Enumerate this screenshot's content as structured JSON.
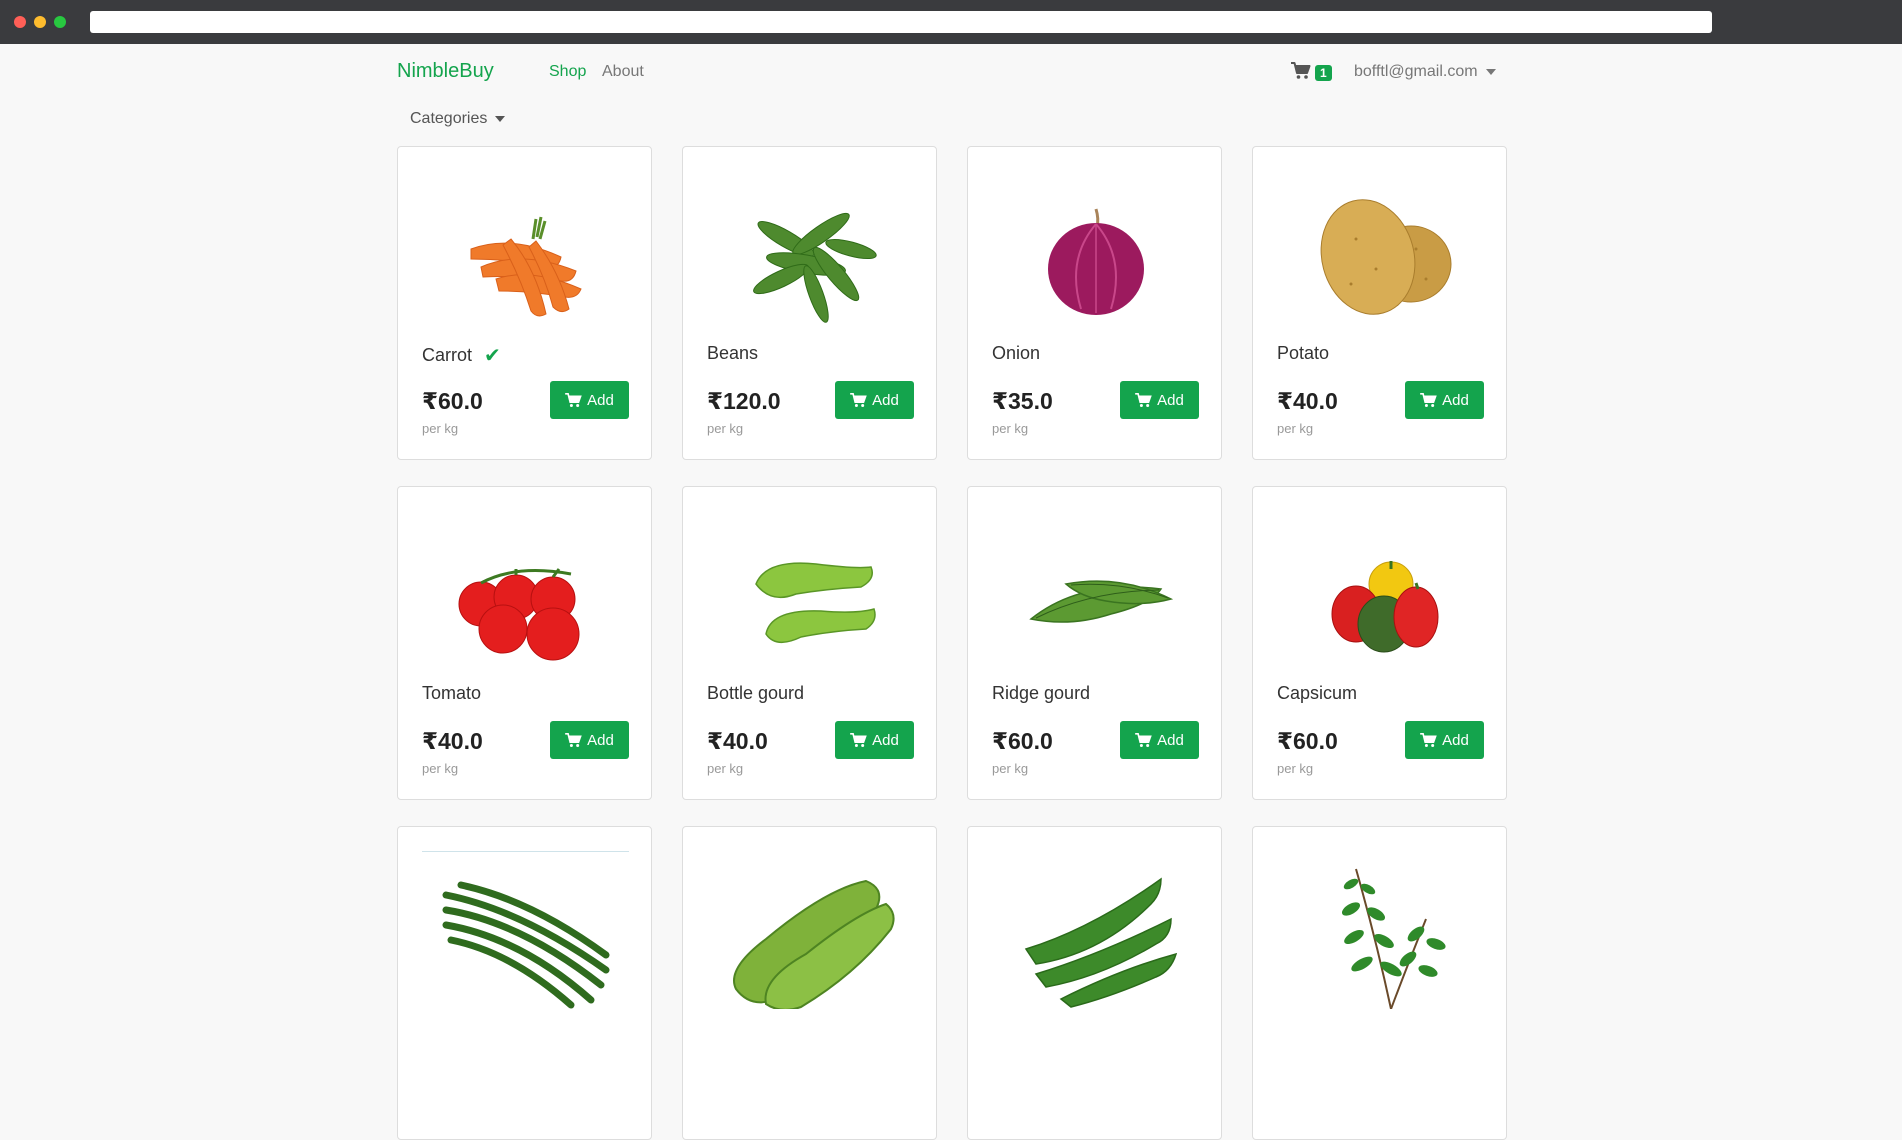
{
  "navbar": {
    "brand": "NimbleBuy",
    "links": [
      {
        "label": "Shop",
        "active": true
      },
      {
        "label": "About",
        "active": false
      }
    ],
    "cart_count": "1",
    "cart_icon": "cart-icon",
    "user_email": "bofftl@gmail.com"
  },
  "filters": {
    "categories_label": "Categories"
  },
  "colors": {
    "accent": "#14a44d",
    "page_bg": "#f8f8f8"
  },
  "products": [
    {
      "name": "Carrot",
      "in_cart": true,
      "price": "₹60.0",
      "unit": "per kg",
      "add_label": "Add",
      "image": "carrot"
    },
    {
      "name": "Beans",
      "in_cart": false,
      "price": "₹120.0",
      "unit": "per kg",
      "add_label": "Add",
      "image": "beans"
    },
    {
      "name": "Onion",
      "in_cart": false,
      "price": "₹35.0",
      "unit": "per kg",
      "add_label": "Add",
      "image": "onion"
    },
    {
      "name": "Potato",
      "in_cart": false,
      "price": "₹40.0",
      "unit": "per kg",
      "add_label": "Add",
      "image": "potato"
    },
    {
      "name": "Tomato",
      "in_cart": false,
      "price": "₹40.0",
      "unit": "per kg",
      "add_label": "Add",
      "image": "tomato"
    },
    {
      "name": "Bottle gourd",
      "in_cart": false,
      "price": "₹40.0",
      "unit": "per kg",
      "add_label": "Add",
      "image": "bottle-gourd"
    },
    {
      "name": "Ridge gourd",
      "in_cart": false,
      "price": "₹60.0",
      "unit": "per kg",
      "add_label": "Add",
      "image": "ridge-gourd"
    },
    {
      "name": "Capsicum",
      "in_cart": false,
      "price": "₹60.0",
      "unit": "per kg",
      "add_label": "Add",
      "image": "capsicum"
    },
    {
      "name": "",
      "in_cart": false,
      "price": "",
      "unit": "",
      "add_label": "",
      "image": "drumstick"
    },
    {
      "name": "",
      "in_cart": false,
      "price": "",
      "unit": "",
      "add_label": "",
      "image": "cucumber"
    },
    {
      "name": "",
      "in_cart": false,
      "price": "",
      "unit": "",
      "add_label": "",
      "image": "okra"
    },
    {
      "name": "",
      "in_cart": false,
      "price": "",
      "unit": "",
      "add_label": "",
      "image": "curry-leaves"
    }
  ]
}
